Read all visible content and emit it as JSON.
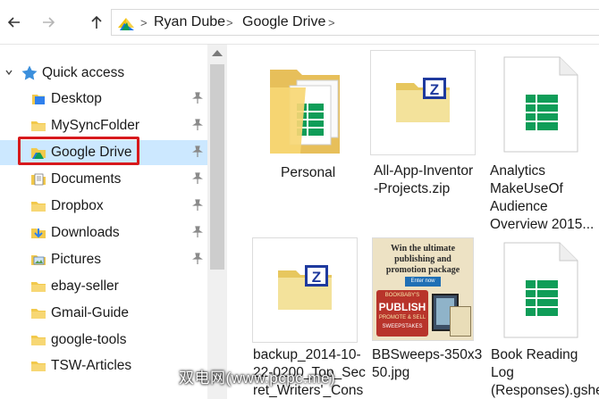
{
  "address": {
    "crumbs": [
      "Ryan Dube",
      "Google Drive"
    ]
  },
  "nav": {
    "quick_access": "Quick access",
    "items": [
      {
        "label": "Desktop",
        "icon": "desktop-icon",
        "pinned": true
      },
      {
        "label": "MySyncFolder",
        "icon": "folder-icon",
        "pinned": true
      },
      {
        "label": "Google Drive",
        "icon": "google-drive-icon",
        "pinned": true,
        "selected": true
      },
      {
        "label": "Documents",
        "icon": "documents-icon",
        "pinned": true
      },
      {
        "label": "Dropbox",
        "icon": "folder-icon",
        "pinned": true
      },
      {
        "label": "Downloads",
        "icon": "downloads-icon",
        "pinned": true
      },
      {
        "label": "Pictures",
        "icon": "pictures-icon",
        "pinned": true
      },
      {
        "label": "ebay-seller",
        "icon": "folder-icon",
        "pinned": false
      },
      {
        "label": "Gmail-Guide",
        "icon": "folder-icon",
        "pinned": false
      },
      {
        "label": "google-tools",
        "icon": "folder-icon",
        "pinned": false
      },
      {
        "label": "TSW-Articles",
        "icon": "folder-icon",
        "pinned": false
      }
    ]
  },
  "files": [
    {
      "name_lines": [
        "Personal"
      ],
      "kind": "folder-with-sheet"
    },
    {
      "name_lines": [
        "All-App-Inventor",
        "-Projects.zip"
      ],
      "kind": "zip"
    },
    {
      "name_lines": [
        "Analytics",
        "MakeUseOf",
        "Audience",
        "Overview 2015..."
      ],
      "kind": "sheet"
    },
    {
      "name_lines": [
        "backup_2014-10-",
        "22-0200_Top_Sec",
        "ret_Writers'_Cons"
      ],
      "kind": "zip"
    },
    {
      "name_lines": [
        "BBSweeps-350x3",
        "50.jpg"
      ],
      "kind": "image"
    },
    {
      "name_lines": [
        "Book Reading",
        "Log",
        "(Responses).gshe"
      ],
      "kind": "sheet"
    }
  ],
  "promo": {
    "headline": "Win the ultimate publishing and promotion package",
    "button": "Enter now",
    "badge_top": "BOOKBABY'S",
    "badge_mid": "PUBLISH",
    "badge_sub": "PROMOTE & SELL",
    "badge_bottom": "SWEEPSTAKES"
  },
  "watermark": "双电网(www.pcpc.me)",
  "colors": {
    "selected_bg": "#cce8ff",
    "highlight_box": "#d7191c",
    "sheets_green": "#0f9d58",
    "folder_yellow": "#f7d774"
  }
}
